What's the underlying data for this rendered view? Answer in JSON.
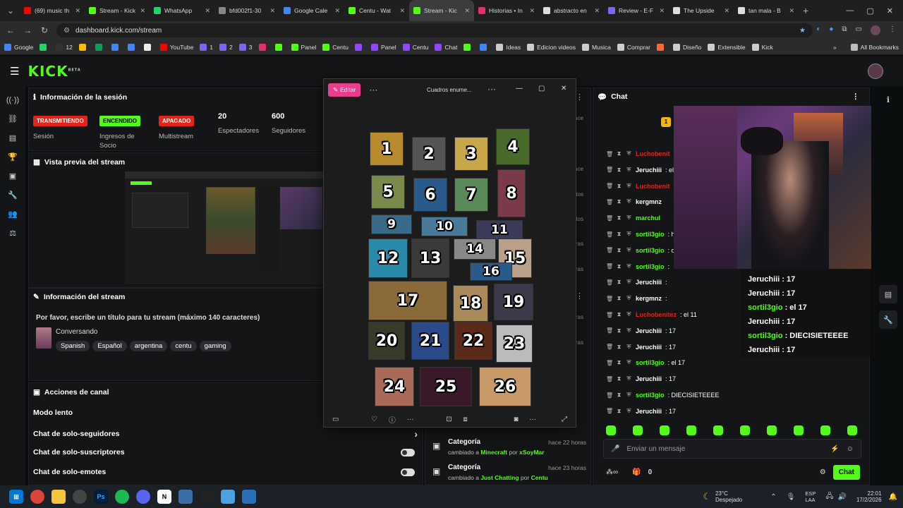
{
  "browser": {
    "tabs": [
      {
        "title": "(69) music th",
        "color": "#ff0000"
      },
      {
        "title": "Stream - Kick",
        "color": "#53fc18"
      },
      {
        "title": "WhatsApp",
        "color": "#25d366"
      },
      {
        "title": "bfd002f1-30",
        "color": "#888888"
      },
      {
        "title": "Google Cale",
        "color": "#4285f4"
      },
      {
        "title": "Centu - Wat",
        "color": "#53fc18"
      },
      {
        "title": "Stream - Kic",
        "color": "#53fc18"
      },
      {
        "title": "Historias • In",
        "color": "#e1306c"
      },
      {
        "title": "abstracto en",
        "color": "#dddddd"
      },
      {
        "title": "Review - E-F",
        "color": "#7b68ee"
      },
      {
        "title": "The Upside",
        "color": "#dddddd"
      },
      {
        "title": "tan mala - B",
        "color": "#dddddd"
      }
    ],
    "active_tab_index": 6,
    "new_tab_label": "+",
    "url": "dashboard.kick.com/stream",
    "bookmarks": [
      {
        "label": "Google",
        "color": "#4285f4"
      },
      {
        "label": "",
        "color": "#25d366"
      },
      {
        "label": "12",
        "color": "#333333"
      },
      {
        "label": "",
        "color": "#fbbc05"
      },
      {
        "label": "",
        "color": "#0f9d58"
      },
      {
        "label": "",
        "color": "#4285f4"
      },
      {
        "label": "",
        "color": "#4285f4"
      },
      {
        "label": "",
        "color": "#eeeeee"
      },
      {
        "label": "YouTube",
        "color": "#ff0000"
      },
      {
        "label": "1",
        "color": "#7b68ee"
      },
      {
        "label": "2",
        "color": "#7b68ee"
      },
      {
        "label": "3",
        "color": "#7b68ee"
      },
      {
        "label": "",
        "color": "#e1306c"
      },
      {
        "label": "",
        "color": "#53fc18"
      },
      {
        "label": "Panel",
        "color": "#53fc18"
      },
      {
        "label": "Centu",
        "color": "#53fc18"
      },
      {
        "label": "",
        "color": "#9146ff"
      },
      {
        "label": "Panel",
        "color": "#9146ff"
      },
      {
        "label": "Centu",
        "color": "#9146ff"
      },
      {
        "label": "Chat",
        "color": "#9146ff"
      },
      {
        "label": "",
        "color": "#53fc18"
      },
      {
        "label": "",
        "color": "#4285f4"
      },
      {
        "label": "Ideas",
        "color": "#cccccc"
      },
      {
        "label": "Edicion videos",
        "color": "#cccccc"
      },
      {
        "label": "Musica",
        "color": "#cccccc"
      },
      {
        "label": "Comprar",
        "color": "#cccccc"
      },
      {
        "label": "",
        "color": "#ff6633"
      },
      {
        "label": "Diseño",
        "color": "#cccccc"
      },
      {
        "label": "Extensible",
        "color": "#cccccc"
      },
      {
        "label": "Kick",
        "color": "#cccccc"
      }
    ],
    "all_bookmarks": "All Bookmarks"
  },
  "kick": {
    "logo": "KICK",
    "logo_sup": "BETA",
    "session": {
      "title": "Información de la sesión",
      "badges": [
        {
          "text": "TRANSMITIENDO",
          "label": "Sesión",
          "color": "#e1251b",
          "textcolor": "#ffffff"
        },
        {
          "text": "ENCENDIDO",
          "label": "Ingresos de Socio",
          "color": "#53fc18",
          "textcolor": "#000000"
        },
        {
          "text": "APAGADO",
          "label": "Multistream",
          "color": "#e1251b",
          "textcolor": "#ffffff"
        }
      ],
      "stats": [
        {
          "value": "20",
          "label": "Espectadores"
        },
        {
          "value": "600",
          "label": "Seguidores"
        }
      ]
    },
    "preview": {
      "title": "Vista previa del stream"
    },
    "stream_info": {
      "title": "Información del stream",
      "stream_title": "Por favor, escribe un título para tu stream (máximo 140 caracteres)",
      "category": "Conversando",
      "tags": [
        "Spanish",
        "Español",
        "argentina",
        "centu",
        "gaming"
      ]
    },
    "actions": {
      "title": "Acciones de canal",
      "items": [
        "Modo lento",
        "Chat de solo-seguidores",
        "Chat de solo-suscriptores",
        "Chat de solo-emotes"
      ]
    },
    "activity": [
      {
        "title": "Categoría",
        "time": "hace 22 horas",
        "pre": "cambiado a ",
        "value": "Minecraft",
        "by": " por ",
        "user": "xSoyMar"
      },
      {
        "title": "Categoría",
        "time": "hace 23 horas",
        "pre": "cambiado a ",
        "value": "Just Chatting",
        "by": " por ",
        "user": "Centu"
      }
    ],
    "activity_times_partial": [
      "hace",
      "hace",
      "ntos",
      "ntos",
      "horas",
      "horas",
      "horas",
      "horas"
    ]
  },
  "viewer": {
    "title": "Cuadros enume...",
    "edit": "Editar",
    "tiles": [
      "1",
      "2",
      "3",
      "4",
      "5",
      "6",
      "7",
      "8",
      "9",
      "10",
      "11",
      "12",
      "13",
      "14",
      "15",
      "16",
      "17",
      "18",
      "19",
      "20",
      "21",
      "22",
      "23",
      "24",
      "25",
      "26"
    ]
  },
  "chat": {
    "title": "Chat",
    "pinned_count": "1",
    "messages": [
      {
        "user": "Luchobenit",
        "text": "",
        "color": "#e1251b"
      },
      {
        "user": "Jeruchiii",
        "text": ": el",
        "color": "#ffffff"
      },
      {
        "user": "Luchobenit",
        "text": "",
        "color": "#e1251b"
      },
      {
        "user": "kergmnz",
        "text": "",
        "color": "#ffffff"
      },
      {
        "user": "marchul",
        "text": "",
        "color": "#53fc18"
      },
      {
        "user": "sortil3gio",
        "text": ": h",
        "color": "#53fc18"
      },
      {
        "user": "sortil3gio",
        "text": ": q",
        "color": "#53fc18"
      },
      {
        "user": "sortil3gio",
        "text": ":",
        "color": "#53fc18"
      },
      {
        "user": "Jeruchiii",
        "text": ":",
        "color": "#ffffff"
      },
      {
        "user": "kergmnz",
        "text": ":",
        "color": "#ffffff"
      },
      {
        "user": "Luchobenitez",
        "text": ": el 11",
        "color": "#e1251b"
      },
      {
        "user": "Jeruchiii",
        "text": ": 17",
        "color": "#ffffff"
      },
      {
        "user": "Jeruchiii",
        "text": ": 17",
        "color": "#ffffff"
      },
      {
        "user": "sortil3gio",
        "text": ": el 17",
        "color": "#53fc18"
      },
      {
        "user": "Jeruchiii",
        "text": ": 17",
        "color": "#ffffff"
      },
      {
        "user": "sortil3gio",
        "text": ": DIECISIETEEEE",
        "color": "#53fc18"
      },
      {
        "user": "Jeruchiii",
        "text": ": 17",
        "color": "#ffffff"
      }
    ],
    "overlay": [
      {
        "user": "Jeruchiii",
        "text": " : 17",
        "color": "#ffffff"
      },
      {
        "user": "Jeruchiii",
        "text": " : 17",
        "color": "#ffffff"
      },
      {
        "user": "sortil3gio",
        "text": " : el 17",
        "color": "#53fc18"
      },
      {
        "user": "Jeruchiii",
        "text": " : 17",
        "color": "#ffffff"
      },
      {
        "user": "sortil3gio",
        "text": " : DIECISIETEEEE",
        "color": "#53fc18"
      },
      {
        "user": "Jeruchiii",
        "text": " : 17",
        "color": "#ffffff"
      }
    ],
    "input_placeholder": "Enviar un mensaje",
    "points": "0",
    "send": "Chat"
  },
  "taskbar": {
    "weather_temp": "23°C",
    "weather_desc": "Despejado",
    "lang1": "ESP",
    "lang2": "LAA",
    "time": "22:01",
    "date": "17/2/2026"
  }
}
